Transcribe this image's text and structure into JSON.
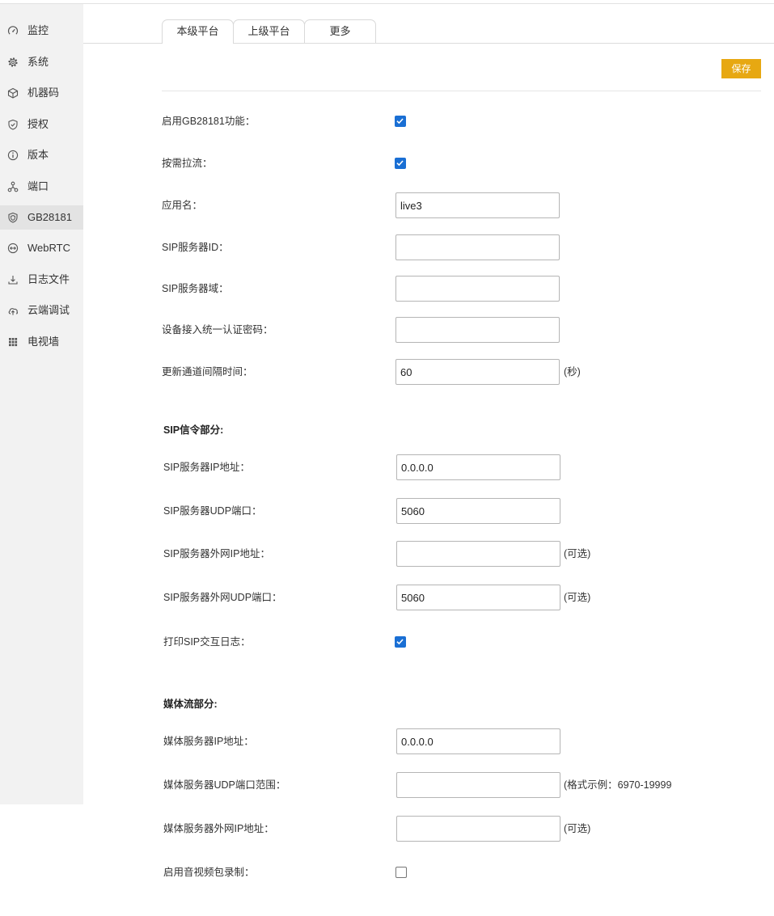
{
  "colors": {
    "accent": "#e7a812",
    "checkbox": "#1a6fd4",
    "sidebar_bg": "#f2f2f2",
    "sidebar_active_bg": "#e3e3e3"
  },
  "sidebar": {
    "items": [
      {
        "label": "监控",
        "icon": "gauge-icon"
      },
      {
        "label": "系统",
        "icon": "gear-icon"
      },
      {
        "label": "机器码",
        "icon": "cube-icon"
      },
      {
        "label": "授权",
        "icon": "shield-check-icon"
      },
      {
        "label": "版本",
        "icon": "info-icon"
      },
      {
        "label": "端口",
        "icon": "network-icon"
      },
      {
        "label": "GB28181",
        "icon": "shield-icon",
        "active": true
      },
      {
        "label": "WebRTC",
        "icon": "exchange-icon"
      },
      {
        "label": "日志文件",
        "icon": "download-icon"
      },
      {
        "label": "云端调试",
        "icon": "cloud-upload-icon"
      },
      {
        "label": "电视墙",
        "icon": "grid-icon"
      }
    ]
  },
  "tabs": [
    {
      "label": "本级平台",
      "active": true
    },
    {
      "label": "上级平台"
    },
    {
      "label": "更多"
    }
  ],
  "toolbar": {
    "save_label": "保存"
  },
  "general": {
    "enable_gb28181": {
      "label": "启用GB28181功能：",
      "checked": true
    },
    "on_demand_pull": {
      "label": "按需拉流：",
      "checked": true
    },
    "app_name": {
      "label": "应用名：",
      "value": "live3"
    },
    "sip_server_id": {
      "label": "SIP服务器ID：",
      "value": ""
    },
    "sip_server_domain": {
      "label": "SIP服务器域：",
      "value": ""
    },
    "device_auth_password": {
      "label": "设备接入统一认证密码：",
      "value": ""
    },
    "channel_update_interval": {
      "label": "更新通道间隔时间：",
      "value": "60",
      "suffix": "(秒)"
    }
  },
  "sip": {
    "title": "SIP信令部分:",
    "server_ip": {
      "label": "SIP服务器IP地址：",
      "value": "0.0.0.0"
    },
    "server_udp_port": {
      "label": "SIP服务器UDP端口：",
      "value": "5060"
    },
    "external_ip": {
      "label": "SIP服务器外网IP地址：",
      "value": "",
      "suffix": "(可选)"
    },
    "external_udp_port": {
      "label": "SIP服务器外网UDP端口：",
      "value": "5060",
      "suffix": "(可选)"
    },
    "log_sip": {
      "label": "打印SIP交互日志：",
      "checked": true
    }
  },
  "media": {
    "title": "媒体流部分:",
    "server_ip": {
      "label": "媒体服务器IP地址：",
      "value": "0.0.0.0"
    },
    "udp_port_range": {
      "label": "媒体服务器UDP端口范围：",
      "value": "",
      "suffix": "(格式示例：6970-19999"
    },
    "external_ip": {
      "label": "媒体服务器外网IP地址：",
      "value": "",
      "suffix": "(可选)"
    },
    "enable_recording": {
      "label": "启用音视频包录制：",
      "checked": false
    }
  }
}
